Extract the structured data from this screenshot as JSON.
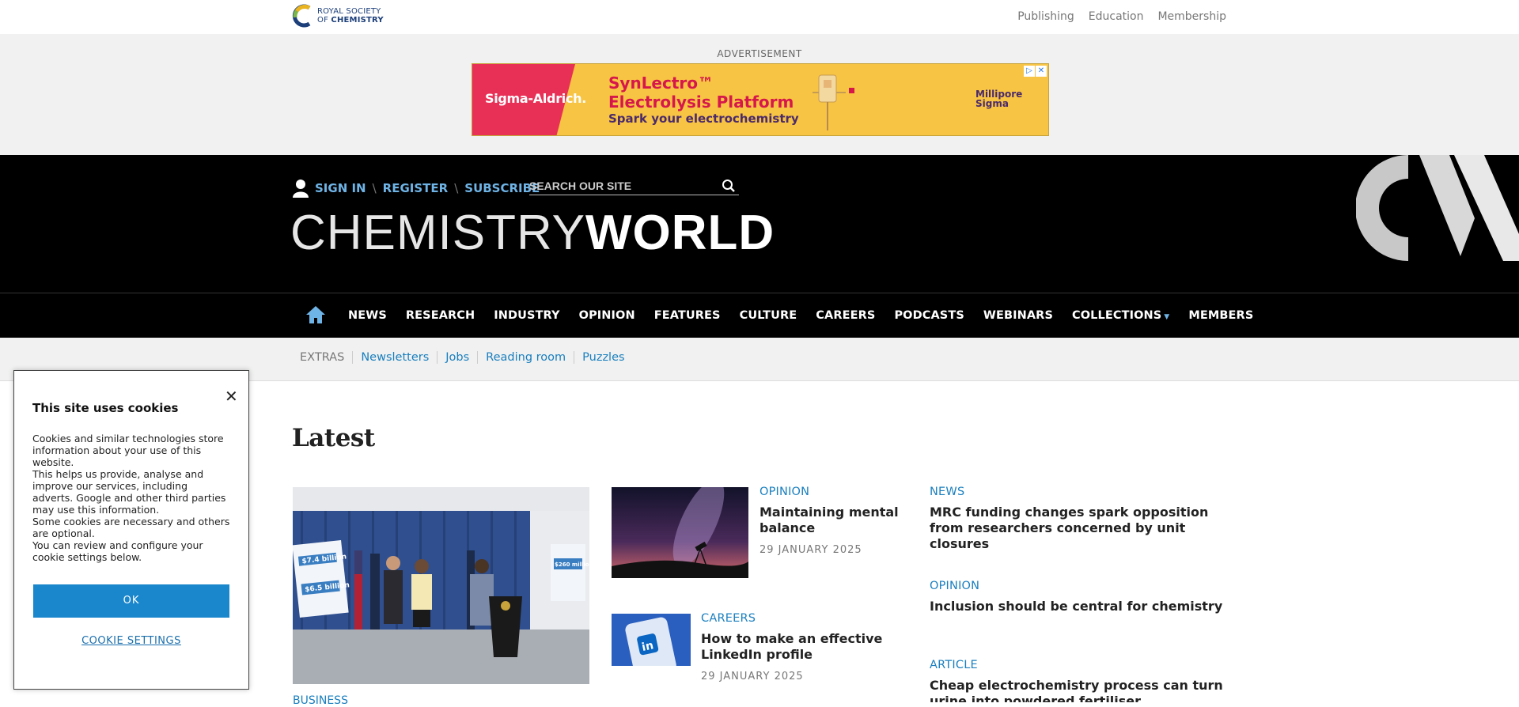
{
  "topbar": {
    "logo": {
      "line1": "ROYAL SOCIETY",
      "line2": "OF",
      "line3": "CHEMISTRY"
    },
    "links": [
      "Publishing",
      "Education",
      "Membership"
    ]
  },
  "ad": {
    "label": "ADVERTISEMENT",
    "brand": "Sigma-Aldrich.",
    "headline1": "SynLectro™",
    "headline2": "Electrolysis Platform",
    "tagline": "Spark your electrochemistry",
    "partner_line1": "Millipore",
    "partner_line2": "Sigma"
  },
  "header": {
    "sign_in": "SIGN IN",
    "register": "REGISTER",
    "subscribe": "SUBSCRIBE",
    "search_placeholder": "SEARCH OUR SITE",
    "brand_left": "CHEMISTRY",
    "brand_right": "WORLD"
  },
  "nav": {
    "items": [
      "NEWS",
      "RESEARCH",
      "INDUSTRY",
      "OPINION",
      "FEATURES",
      "CULTURE",
      "CAREERS",
      "PODCASTS",
      "WEBINARS",
      "COLLECTIONS",
      "MEMBERS"
    ]
  },
  "extras": {
    "label": "EXTRAS",
    "items": [
      "Newsletters",
      "Jobs",
      "Reading room",
      "Puzzles"
    ]
  },
  "main": {
    "heading": "Latest",
    "hero_section": "BUSINESS",
    "mid_articles": [
      {
        "section": "OPINION",
        "title": "Maintaining mental balance",
        "date": "29 JANUARY 2025"
      },
      {
        "section": "CAREERS",
        "title": "How to make an effective LinkedIn profile",
        "date": "29 JANUARY 2025"
      }
    ],
    "right_articles": [
      {
        "section": "NEWS",
        "title": "MRC funding changes spark opposition from researchers concerned by unit closures"
      },
      {
        "section": "OPINION",
        "title": "Inclusion should be central for chemistry"
      },
      {
        "section": "ARTICLE",
        "title": "Cheap electrochemistry process can turn urine into powdered fertiliser"
      }
    ],
    "hero_poster_left": {
      "top": "$7.4 billion",
      "bottom": "$6.5 billion"
    },
    "hero_poster_right": "$260 million"
  },
  "cookie": {
    "title": "This site uses cookies",
    "p1": "Cookies and similar technologies store information about your use of this website.",
    "p2": "This helps us provide, analyse and improve our services, including adverts. Google and other third parties may use this information.",
    "p3": "Some cookies are necessary and others are optional.",
    "p4": "You can review and configure your cookie settings below.",
    "ok": "OK",
    "settings": "COOKIE SETTINGS"
  },
  "colors": {
    "accent": "#1a7fbf",
    "link_light": "#6fb4e6",
    "header_bg": "#000000",
    "ok_button": "#1a86cc"
  }
}
